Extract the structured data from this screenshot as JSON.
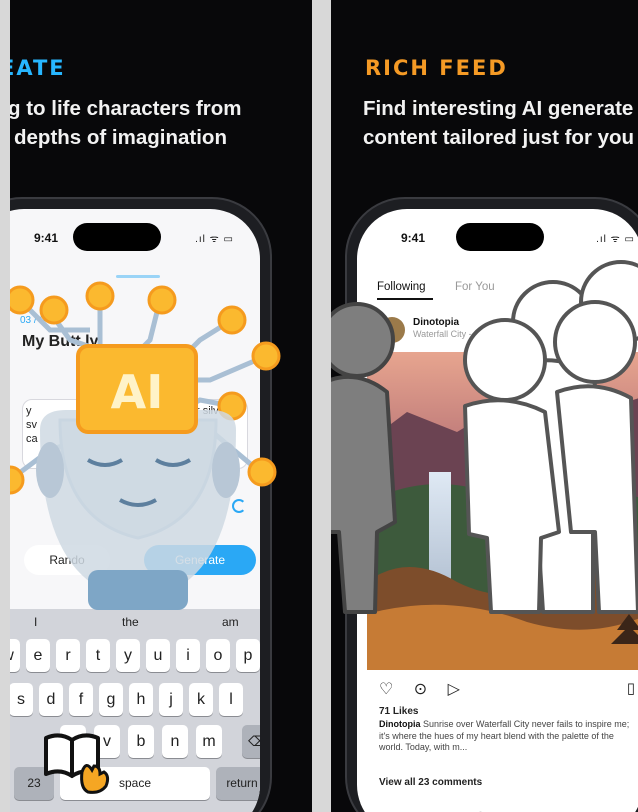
{
  "left_panel": {
    "tag": "EATE",
    "headline_1": "g to life characters from",
    "headline_2": "depths of imagination",
    "phone": {
      "time": "9:41",
      "status": ".ıl ᯤ ▭",
      "step": "03 / 0",
      "title": "My Butt   ly",
      "field_text": "r silver",
      "field_partial_1": "y",
      "field_partial_2": "sv",
      "field_partial_3": "ca",
      "random_label": "Rando",
      "generate_label": "Generate",
      "suggestions": [
        "I",
        "the",
        "am"
      ],
      "keys_row1": [
        "w",
        "e",
        "r",
        "t",
        "y",
        "u",
        "i",
        "o",
        "p"
      ],
      "keys_row2": [
        "s",
        "d",
        "f",
        "g",
        "h",
        "j",
        "k",
        "l"
      ],
      "keys_row3": [
        "z",
        "v",
        "b",
        "n",
        "m"
      ],
      "key_23": "23",
      "space": "space",
      "return": "return",
      "delete_icon": "⌫"
    },
    "ai_chip_text": "AI"
  },
  "right_panel": {
    "tag": "RICH FEED",
    "headline_1": "Find interesting AI generate",
    "headline_2": "content tailored just for you",
    "phone": {
      "time": "9:41",
      "status": ".ıl ᯤ ▭",
      "tab_following": "Following",
      "tab_for_you": "For You",
      "username": "Dinotopia",
      "location": "Waterfall City - 8",
      "likes": "71 Likes",
      "caption_user": "Dinotopia",
      "caption": "Sunrise over Waterfall City never fails to inspire me; it's where the hues of my heart blend with the palette of the world. Today, with m...",
      "view_all": "View all 23 comments",
      "action_icons": "♡ ⊙ ▷",
      "bookmark": "▯",
      "bottom_nav": "⌂ ⚲ + ▭ ◉"
    }
  },
  "colors": {
    "create_blue": "#27b6ff",
    "rich_feed_orange": "#f59a25",
    "generate_blue": "#2aa8f5"
  }
}
